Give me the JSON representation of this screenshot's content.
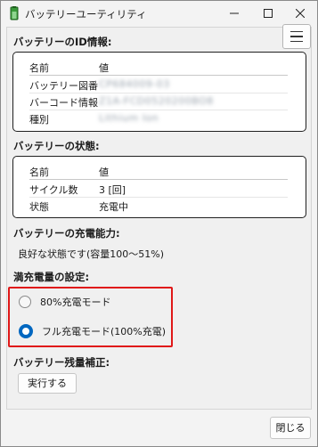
{
  "window": {
    "title": "バッテリーユーティリティ"
  },
  "id_section": {
    "title": "バッテリーのID情報:",
    "header": {
      "name": "名前",
      "value": "値"
    },
    "rows": [
      {
        "name": "バッテリー図番",
        "value": "CP684009-03"
      },
      {
        "name": "バーコード情報",
        "value": "Z1A-FCD0520200BO8"
      },
      {
        "name": "種別",
        "value": "Lithium Ion"
      }
    ]
  },
  "status_section": {
    "title": "バッテリーの状態:",
    "header": {
      "name": "名前",
      "value": "値"
    },
    "rows": [
      {
        "name": "サイクル数",
        "value": "3 [回]"
      },
      {
        "name": "状態",
        "value": "充電中"
      }
    ]
  },
  "capacity_section": {
    "title": "バッテリーの充電能力:",
    "text": "良好な状態です(容量100～51%)"
  },
  "charge_setting": {
    "title": "満充電量の設定:",
    "options": [
      {
        "label": "80%充電モード",
        "selected": false
      },
      {
        "label": "フル充電モード(100%充電)",
        "selected": true
      }
    ],
    "highlight_color": "#e01818",
    "accent_color": "#0067c0"
  },
  "calibration": {
    "title": "バッテリー残量補正:",
    "button": "実行する"
  },
  "footer": {
    "close_button": "閉じる"
  }
}
